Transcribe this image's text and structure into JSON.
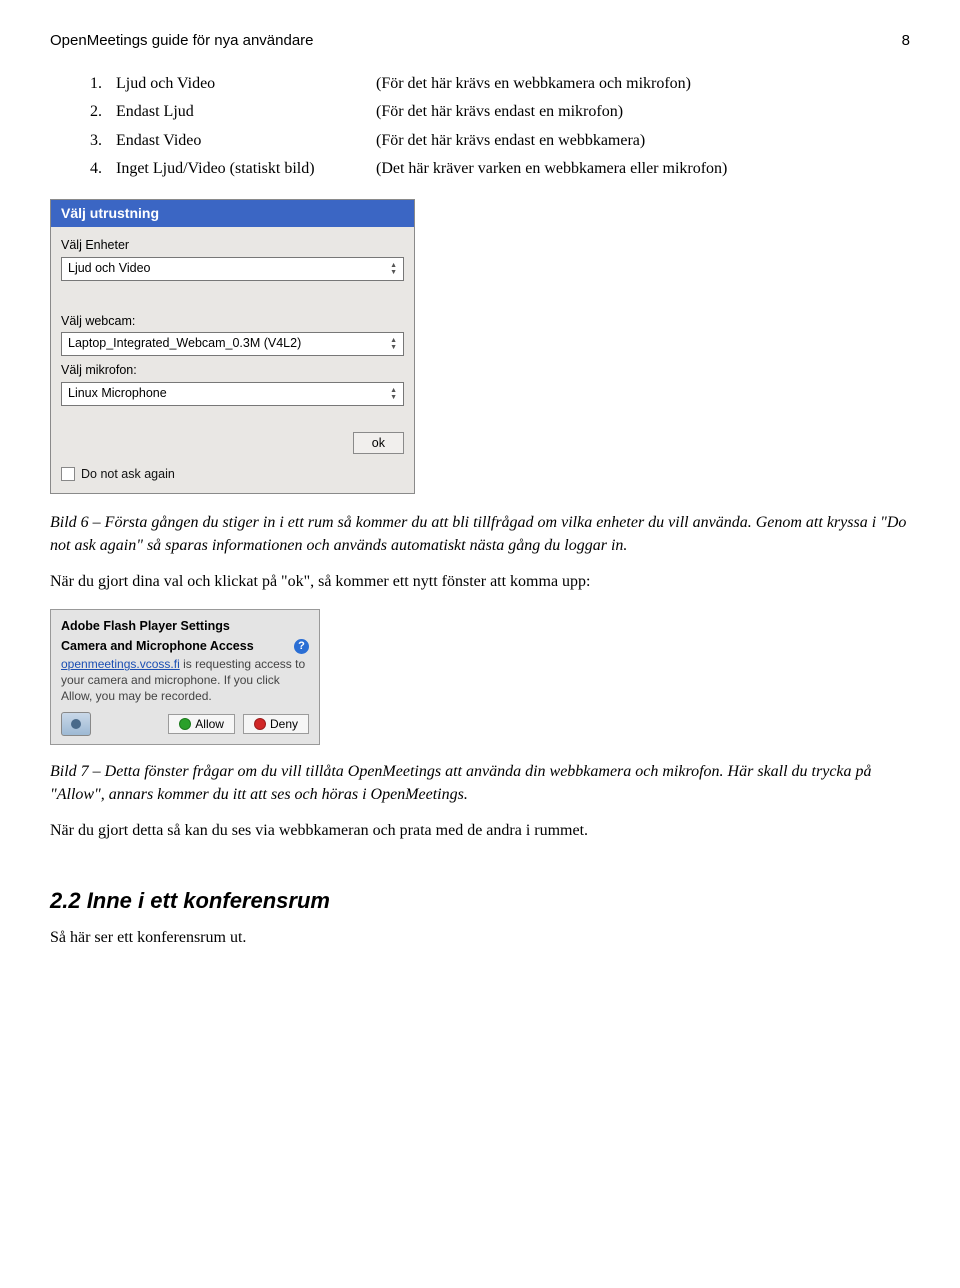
{
  "header": {
    "title": "OpenMeetings guide för nya användare",
    "page": "8"
  },
  "list": [
    {
      "num": "1.",
      "label": "Ljud och Video",
      "note": "(För det här krävs en webbkamera och mikrofon)"
    },
    {
      "num": "2.",
      "label": "Endast Ljud",
      "note": "(För det här krävs endast en mikrofon)"
    },
    {
      "num": "3.",
      "label": "Endast Video",
      "note": "(För det här krävs endast en webbkamera)"
    },
    {
      "num": "4.",
      "label": "Inget Ljud/Video (statiskt bild)",
      "note": "(Det här kräver varken en webbkamera eller mikrofon)"
    }
  ],
  "dialog1": {
    "title": "Välj utrustning",
    "devices_label": "Välj Enheter",
    "devices_value": "Ljud och Video",
    "webcam_label": "Välj webcam:",
    "webcam_value": "Laptop_Integrated_Webcam_0.3M (V4L2)",
    "mic_label": "Välj mikrofon:",
    "mic_value": "Linux Microphone",
    "ok_label": "ok",
    "ask_label": "Do not ask again"
  },
  "caption1": "Bild 6 – Första gången du stiger in i ett rum så kommer du att bli tillfrågad om vilka enheter du vill använda. Genom att kryssa i \"Do not ask again\" så sparas informationen och används automatiskt nästa gång du loggar in.",
  "para1": "När du gjort dina val och klickat på \"ok\",  så kommer ett nytt fönster att komma upp:",
  "flash": {
    "title": "Adobe Flash Player Settings",
    "subtitle": "Camera and Microphone Access",
    "link_text": "openmeetings.vcoss.fi",
    "rest_text": " is requesting access to your camera and microphone. If you click Allow, you may be recorded.",
    "allow": "Allow",
    "deny": "Deny"
  },
  "caption2a": "Bild 7 – Detta fönster frågar om du vill tillåta OpenMeetings att använda din webbkamera och mikrofon. Här skall du trycka på \"Allow\", annars kommer du itt att ses och höras i OpenMeetings.",
  "para2": "När du gjort detta så kan du ses via webbkameran och prata med de andra i rummet.",
  "section": {
    "heading": "2.2 Inne i ett konferensrum",
    "intro": "Så här ser ett konferensrum ut."
  }
}
